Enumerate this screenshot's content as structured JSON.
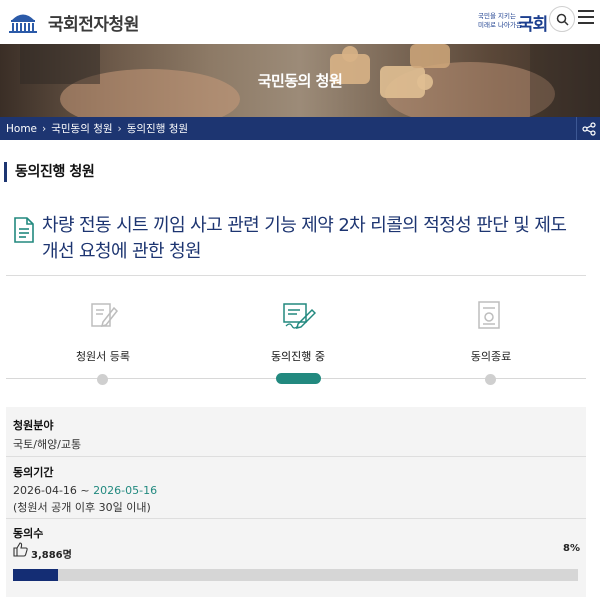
{
  "header": {
    "site_title": "국회전자청원",
    "badge_line1": "국민을 지키는",
    "badge_line2": "미래로 나아가는",
    "badge_big": "국회"
  },
  "banner": {
    "title": "국민동의 청원"
  },
  "breadcrumb": [
    "Home",
    "국민동의 청원",
    "동의진행 청원"
  ],
  "section_title": "동의진행 청원",
  "petition": {
    "title": "차량 전동 시트 끼임 사고 관련 기능 제약 2차 리콜의 적정성 판단 및 제도 개선 요청에 관한 청원"
  },
  "steps": [
    {
      "label": "청원서 등록",
      "icon": "pencil-document-icon",
      "active": false
    },
    {
      "label": "동의진행 중",
      "icon": "signing-document-icon",
      "active": true
    },
    {
      "label": "동의종료",
      "icon": "certificate-icon",
      "active": false
    }
  ],
  "info": {
    "field": {
      "label": "청원분야",
      "value": "국토/해양/교통"
    },
    "period": {
      "label": "동의기간",
      "start": "2026-04-16",
      "separator": " ~ ",
      "end": "2026-05-16",
      "note": "(청원서 공개 이후 30일 이내)"
    },
    "agreement": {
      "label": "동의수",
      "count": "3,886명",
      "percent_text": "8%",
      "progress": 0.08
    }
  },
  "colors": {
    "navy": "#1d3571",
    "teal": "#22897f",
    "bar_fill": "#142d74"
  }
}
